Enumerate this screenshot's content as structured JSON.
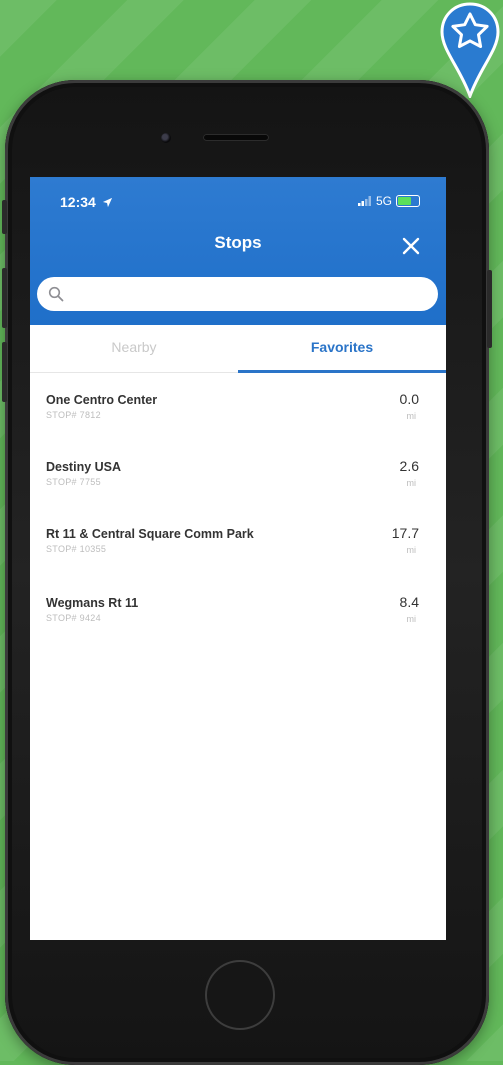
{
  "status_bar": {
    "time": "12:34",
    "network": "5G"
  },
  "header": {
    "title": "Stops"
  },
  "search": {
    "placeholder": "",
    "value": ""
  },
  "tabs": [
    {
      "label": "Nearby",
      "active": false
    },
    {
      "label": "Favorites",
      "active": true
    }
  ],
  "stops": [
    {
      "name": "One Centro Center",
      "stop_number": "STOP# 7812",
      "distance": "0.0",
      "unit": "mi"
    },
    {
      "name": "Destiny USA",
      "stop_number": "STOP# 7755",
      "distance": "2.6",
      "unit": "mi"
    },
    {
      "name": "Rt 11 & Central Square Comm Park",
      "stop_number": "STOP# 10355",
      "distance": "17.7",
      "unit": "mi"
    },
    {
      "name": "Wegmans Rt 11",
      "stop_number": "STOP# 9424",
      "distance": "8.4",
      "unit": "mi"
    }
  ],
  "colors": {
    "background": "#62b85a",
    "header": "#1f6fc9",
    "accent": "#2a74c8",
    "badge": "#2a7bd0"
  },
  "icons": [
    "favorite-star-map-pin-icon",
    "location-arrow-icon",
    "signal-icon",
    "battery-icon",
    "close-icon",
    "search-icon"
  ]
}
